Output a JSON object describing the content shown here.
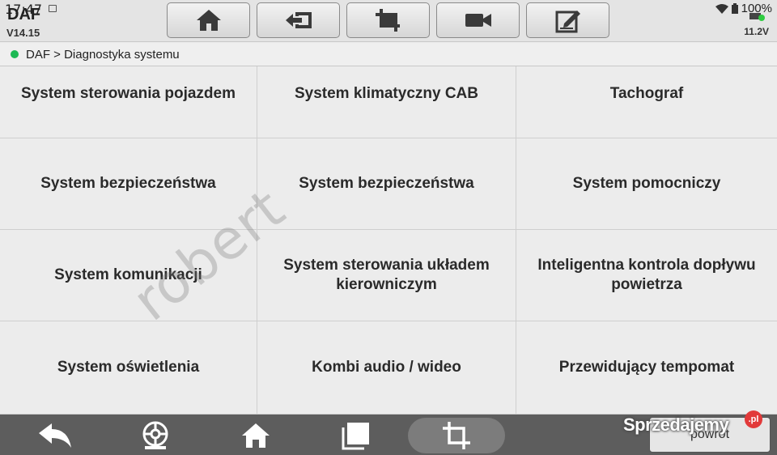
{
  "status_bar": {
    "time": "17:47",
    "battery": "100%"
  },
  "app": {
    "title": "DAF",
    "version": "V14.15",
    "voltage": "11.2V"
  },
  "toolbar": {
    "buttons": [
      {
        "name": "home",
        "icon": "home-icon"
      },
      {
        "name": "exit",
        "icon": "exit-icon"
      },
      {
        "name": "screenshot",
        "icon": "crop-icon"
      },
      {
        "name": "record",
        "icon": "video-icon"
      },
      {
        "name": "notes",
        "icon": "edit-icon"
      }
    ]
  },
  "breadcrumb": {
    "text": "DAF > Diagnostyka systemu"
  },
  "systems": [
    "System sterowania pojazdem",
    "System klimatyczny CAB",
    "Tachograf",
    "System bezpieczeństwa",
    "System bezpieczeństwa",
    "System pomocniczy",
    "System komunikacji",
    "System sterowania układem kierowniczym",
    "Inteligentna kontrola dopływu powietrza",
    "System oświetlenia",
    "Kombi audio / wideo",
    "Przewidujący tempomat"
  ],
  "watermark": "robert",
  "bottom_nav": {
    "back_label": "powrót",
    "icons": [
      "back-arrow-icon",
      "tire-icon",
      "home-icon",
      "recent-apps-icon",
      "crop-icon"
    ]
  },
  "logo": {
    "text": "Sprzedajemy",
    "badge": ".pl"
  },
  "colors": {
    "status_green": "#1db954",
    "bottom_bar": "#5d5d5d"
  }
}
